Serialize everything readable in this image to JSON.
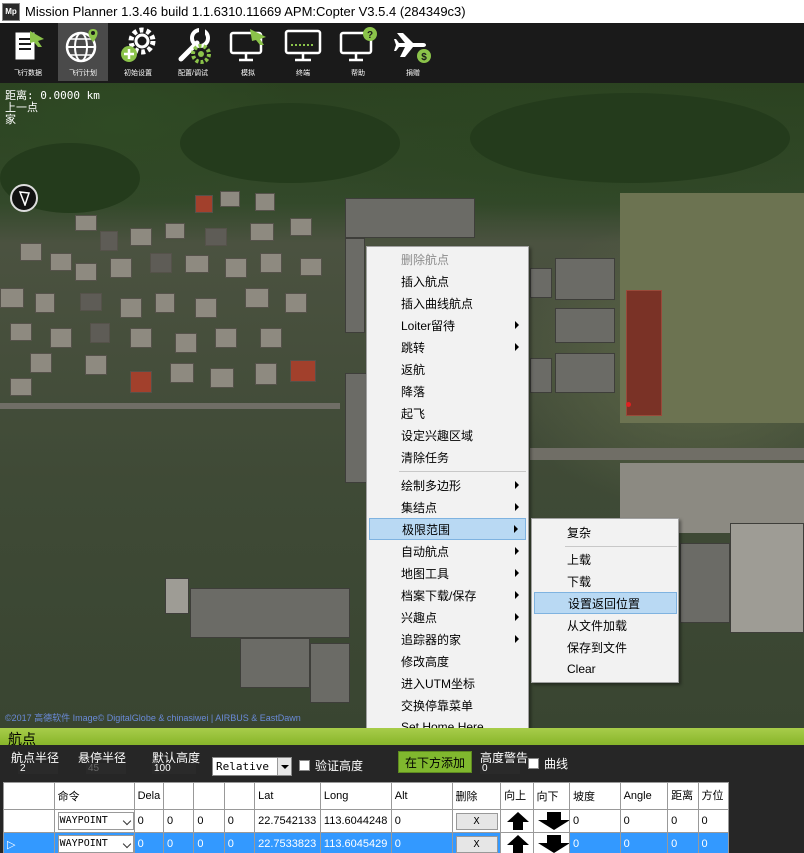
{
  "window": {
    "logo_text": "Mp",
    "title": "Mission Planner 1.3.46 build 1.1.6310.11669 APM:Copter V3.5.4 (284349c3)"
  },
  "toolbar": {
    "items": [
      {
        "label": "飞行数据",
        "icon": "flight-data-icon"
      },
      {
        "label": "飞行计划",
        "icon": "flight-plan-globe-icon",
        "active": true
      },
      {
        "label": "初始设置",
        "icon": "initial-setup-gear-icon"
      },
      {
        "label": "配置/调试",
        "icon": "config-tuning-wrench-icon"
      },
      {
        "label": "模拟",
        "icon": "simulation-monitor-icon"
      },
      {
        "label": "终端",
        "icon": "terminal-monitor-icon"
      },
      {
        "label": "帮助",
        "icon": "help-monitor-icon"
      },
      {
        "label": "捐赠",
        "icon": "donate-plane-icon"
      }
    ]
  },
  "map": {
    "distance_label": "距离: 0.0000 km",
    "prev_point_label": "上一点",
    "home_label": "家",
    "copyright": "©2017 高德软件 Image© DigitalGlobe & chinasiwei | AIRBUS & EastDawn"
  },
  "context_menu": {
    "items": [
      {
        "label": "删除航点",
        "disabled": true
      },
      {
        "label": "插入航点"
      },
      {
        "label": "插入曲线航点"
      },
      {
        "label": "Loiter留待",
        "submenu": true
      },
      {
        "label": "跳转",
        "submenu": true
      },
      {
        "label": "返航"
      },
      {
        "label": "降落"
      },
      {
        "label": "起飞"
      },
      {
        "label": "设定兴趣区域"
      },
      {
        "label": "清除任务"
      },
      {
        "label": "绘制多边形",
        "submenu": true
      },
      {
        "label": "集结点",
        "submenu": true
      },
      {
        "label": "极限范围",
        "submenu": true,
        "highlighted": true
      },
      {
        "label": "自动航点",
        "submenu": true
      },
      {
        "label": "地图工具",
        "submenu": true
      },
      {
        "label": "档案下载/保存",
        "submenu": true
      },
      {
        "label": "兴趣点",
        "submenu": true
      },
      {
        "label": "追踪器的家",
        "submenu": true
      },
      {
        "label": "修改高度"
      },
      {
        "label": "进入UTM坐标"
      },
      {
        "label": "交换停靠菜单"
      },
      {
        "label": "Set Home Here"
      }
    ]
  },
  "submenu": {
    "items": [
      {
        "label": "复杂"
      },
      {
        "label": "上载"
      },
      {
        "label": "下载"
      },
      {
        "label": "设置返回位置",
        "highlighted": true
      },
      {
        "label": "从文件加载"
      },
      {
        "label": "保存到文件"
      },
      {
        "label": "Clear"
      }
    ]
  },
  "waypoints": {
    "header": "航点",
    "wp_radius_label": "航点半径",
    "wp_radius_value": "2",
    "loiter_radius_label": "悬停半径",
    "loiter_radius_value": "45",
    "default_alt_label": "默认高度",
    "default_alt_value": "100",
    "alt_frame": "Relative",
    "verify_height_label": "验证高度",
    "add_below_button": "在下方添加",
    "alt_warning_label": "高度警告",
    "alt_warning_value": "0",
    "spline_label": "曲线",
    "columns": [
      "",
      "命令",
      "Dela",
      "",
      "",
      "",
      "Lat",
      "Long",
      "Alt",
      "删除",
      "向上",
      "向下",
      "坡度",
      "Angle",
      "距离",
      "方位"
    ],
    "rows": [
      {
        "marker": "",
        "command": "WAYPOINT",
        "p1": "0",
        "p2": "0",
        "p3": "0",
        "p4": "0",
        "lat": "22.7542133",
        "long": "113.6044248",
        "alt": "0",
        "delete": "X",
        "grad": "0",
        "angle": "0",
        "dist": "0",
        "az": "0"
      },
      {
        "marker": "▷",
        "command": "WAYPOINT",
        "p1": "0",
        "p2": "0",
        "p3": "0",
        "p4": "0",
        "lat": "22.7533823",
        "long": "113.6045429",
        "alt": "0",
        "delete": "X",
        "grad": "0",
        "angle": "0",
        "dist": "0",
        "az": "0"
      }
    ]
  }
}
